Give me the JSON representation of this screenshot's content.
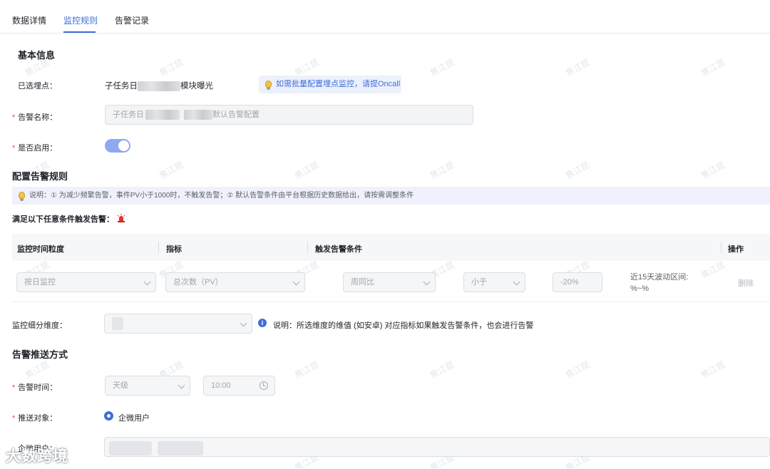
{
  "tabs": [
    {
      "label": "数据详情"
    },
    {
      "label": "监控规则"
    },
    {
      "label": "告警记录"
    }
  ],
  "basic_info": {
    "title": "基本信息",
    "selected_point_label": "已选埋点：",
    "selected_point_prefix": "子任务日",
    "selected_point_suffix": "模块曝光",
    "batch_hint": "如需批量配置埋点监控，请提Oncall",
    "alert_name_label": "告警名称：",
    "alert_name_prefix": "子任务日",
    "alert_name_suffix": "默认告警配置",
    "enabled_label": "是否启用：",
    "enabled": true,
    "required_mark": "*"
  },
  "rules": {
    "title": "配置告警规则",
    "note": "说明：① 为减少频繁告警，事件PV小于1000时，不触发告警；② 默认告警条件由平台根据历史数据给出，请按需调整条件",
    "trigger_label": "满足以下任意条件触发告警：",
    "columns": [
      "监控时间粒度",
      "指标",
      "触发告警条件",
      "操作"
    ],
    "row": {
      "granularity": "按日监控",
      "metric": "总次数（PV）",
      "compare": "周同比",
      "operator": "小于",
      "threshold": "-20%",
      "range_label": "近15天波动区间:",
      "range_value": "%~%",
      "delete_label": "删除"
    },
    "dimension_label": "监控细分维度：",
    "dimension_note": "说明：所选维度的维值 (如安卓) 对应指标如果触发告警条件，也会进行告警"
  },
  "push": {
    "title": "告警推送方式",
    "time_label": "告警时间：",
    "time_unit": "天级",
    "time_value": "10:00",
    "target_label": "推送对象：",
    "target_option": "企微用户",
    "wecom_label": "企微用户："
  },
  "watermark_text": "焦江昆",
  "footer_logo": "大数跨境",
  "colors": {
    "accent": "#3f6fd8",
    "required": "#e34d59",
    "toggle_on": "#8ea9f0"
  },
  "icons": [
    "lightbulb-icon",
    "siren-icon",
    "chevron-down-icon",
    "info-icon",
    "clock-icon",
    "radio-selected-icon"
  ]
}
